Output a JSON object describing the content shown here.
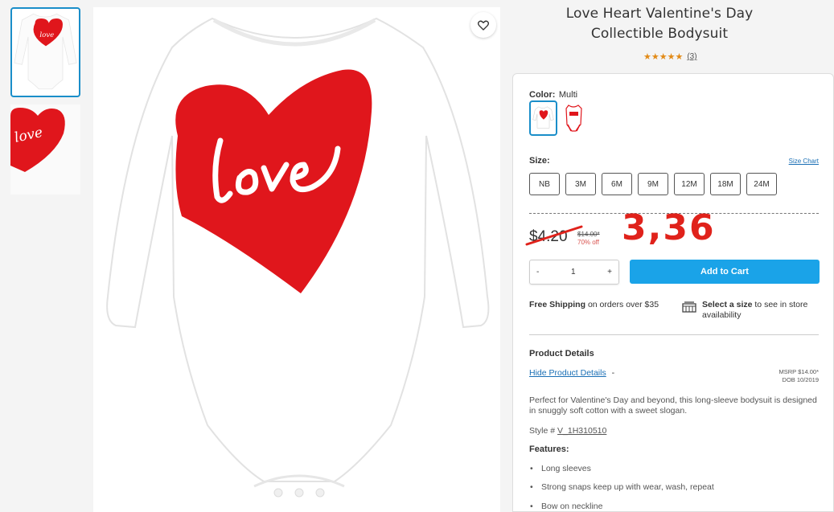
{
  "product": {
    "title": "Love Heart Valentine's Day Collectible Bodysuit",
    "stars": "★★★★★",
    "review_count": "(3)"
  },
  "gallery": {
    "print_text": "love",
    "favorite_icon": "heart-outline-icon"
  },
  "options": {
    "color_label": "Color:",
    "color_value": "Multi",
    "size_label": "Size:",
    "size_chart_link": "Size Chart",
    "sizes": [
      "NB",
      "3M",
      "6M",
      "9M",
      "12M",
      "18M",
      "24M"
    ]
  },
  "pricing": {
    "price": "$4.20",
    "msrp": "$14.00*",
    "discount": "70% off",
    "annotation": "3,36"
  },
  "cart": {
    "minus": "-",
    "quantity": "1",
    "plus": "+",
    "add_to_cart": "Add to Cart"
  },
  "info": {
    "free_shipping_bold": "Free Shipping",
    "free_shipping_rest": "on orders over $35",
    "store_bold": "Select a size",
    "store_rest": "to see in store availability"
  },
  "details": {
    "heading": "Product Details",
    "toggle_link": "Hide Product Details",
    "toggle_dash": "-",
    "msrp_line": "MSRP $14.00*",
    "dob_line": "DOB 10/2019",
    "description": "Perfect for Valentine's Day and beyond, this long-sleeve bodysuit is designed in snuggly soft cotton with a sweet slogan.",
    "style_label": "Style #",
    "style_number": "V_1H310510",
    "features_heading": "Features:",
    "features": [
      "Long sleeves",
      "Strong snaps keep up with wear, wash, repeat",
      "Bow on neckline"
    ]
  },
  "colors": {
    "accent": "#1aa3e8",
    "heart_red": "#e0161c",
    "annotation_red": "#e0221b",
    "stars": "#e28a16"
  }
}
